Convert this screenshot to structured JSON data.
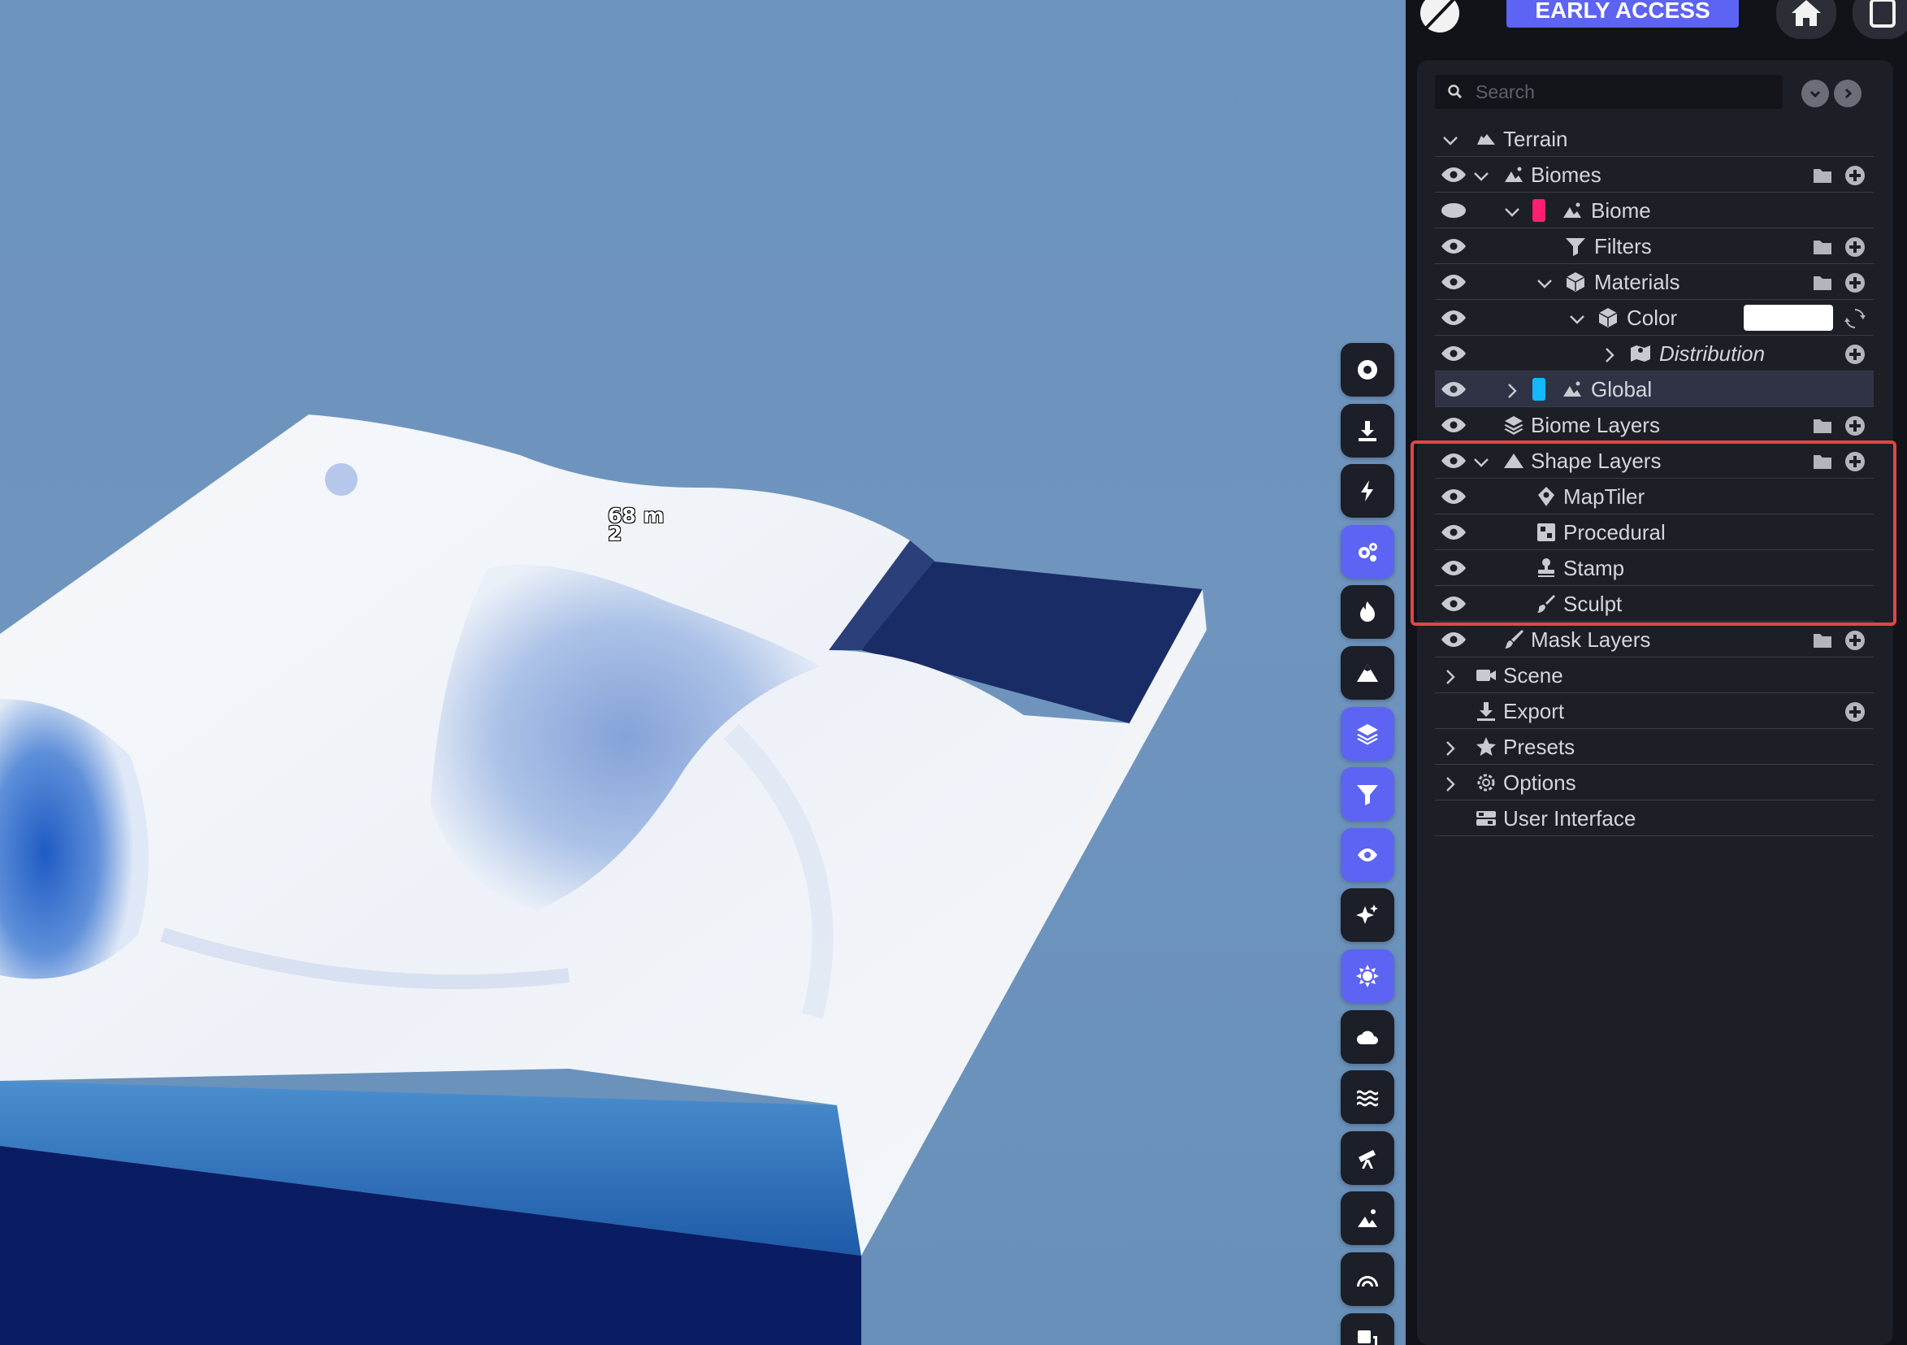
{
  "viewport": {
    "elevation_label": "68 m",
    "elevation_sub": "2"
  },
  "header": {
    "early_access_label": "EARLY ACCESS"
  },
  "search": {
    "placeholder": "Search"
  },
  "tree": {
    "terrain": "Terrain",
    "biomes": "Biomes",
    "biome": "Biome",
    "filters": "Filters",
    "materials": "Materials",
    "color": "Color",
    "distribution": "Distribution",
    "global": "Global",
    "biome_layers": "Biome Layers",
    "shape_layers": "Shape Layers",
    "maptiler": "MapTiler",
    "procedural": "Procedural",
    "stamp": "Stamp",
    "sculpt": "Sculpt",
    "mask_layers": "Mask Layers",
    "scene": "Scene",
    "export": "Export",
    "presets": "Presets",
    "options": "Options",
    "user_interface": "User Interface"
  },
  "colors": {
    "accent": "#5d63f2",
    "biome_swatch": "#ff1f6e",
    "global_swatch": "#14b8ff",
    "material_color": "#ffffff",
    "highlight": "#e04646"
  },
  "toolbar_icons": [
    "target-icon",
    "download-icon",
    "lightning-icon",
    "cogs-icon",
    "fire-icon",
    "mountain-icon",
    "layers-icon",
    "filter-icon",
    "eye-icon",
    "sparkles-icon",
    "sun-icon",
    "cloud-icon",
    "water-icon",
    "telescope-icon",
    "biome-icon",
    "rainbow-icon",
    "resize-icon"
  ]
}
